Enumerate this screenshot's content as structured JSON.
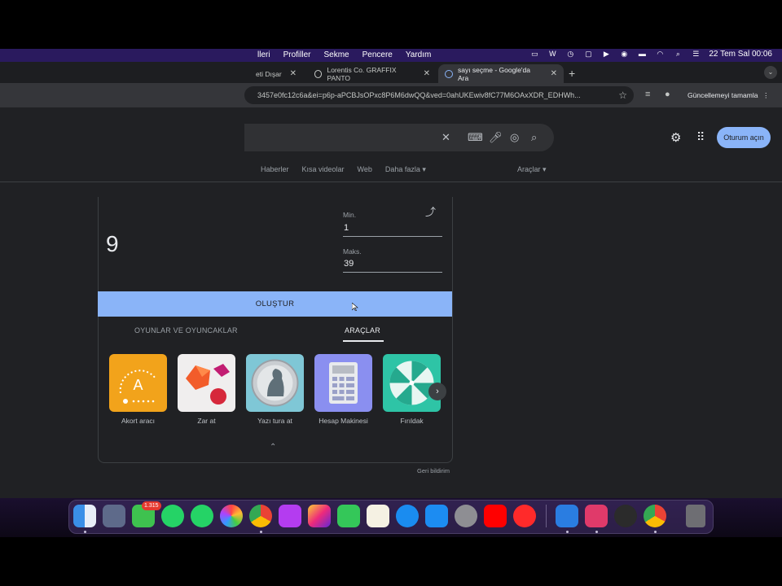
{
  "menubar": {
    "items": [
      "lleri",
      "Profiller",
      "Sekme",
      "Pencere",
      "Yardım"
    ],
    "clock": "22 Tem Sal  00:06"
  },
  "browser": {
    "tabs": [
      {
        "label": "eti Dışar"
      },
      {
        "label": "Lorentis Co. GRAFFIX PANTO"
      },
      {
        "label": "sayı seçme - Google'da Ara",
        "active": true
      }
    ],
    "new_tab": "+",
    "url": "3457e0fc12c6a&ei=p6p-aPCBJsOPxc8P6M6dwQQ&ved=0ahUKEwiv8fC77M6OAxXDR_EDHWh...",
    "update_button": "Güncellemeyi tamamla"
  },
  "google": {
    "sign_in": "Oturum açın",
    "nav": [
      "Haberler",
      "Kısa videolar",
      "Web",
      "Daha fazla"
    ],
    "tools": "Araçlar"
  },
  "rng": {
    "result": "9",
    "min_label": "Min.",
    "min_value": "1",
    "max_label": "Maks.",
    "max_value": "39",
    "generate_label": "OLUŞTUR",
    "tab_games": "OYUNLAR VE OYUNCAKLAR",
    "tab_tools": "ARAÇLAR",
    "tools": [
      {
        "label": "Akort aracı",
        "color": "#f2a31b"
      },
      {
        "label": "Zar at",
        "color": "#f0eeee"
      },
      {
        "label": "Yazı tura at",
        "color": "#7fc7d6"
      },
      {
        "label": "Hesap Makinesi",
        "color": "#8a8ff0"
      },
      {
        "label": "Fırıldak",
        "color": "#2ec4a6"
      }
    ],
    "tuner_letter": "A",
    "feedback": "Geri bildirim"
  },
  "dock": {
    "messages_badge": "1.315"
  },
  "colors": {
    "accent": "#8ab4f8",
    "page_bg": "#202124",
    "menubar": "#2a1a5e"
  }
}
